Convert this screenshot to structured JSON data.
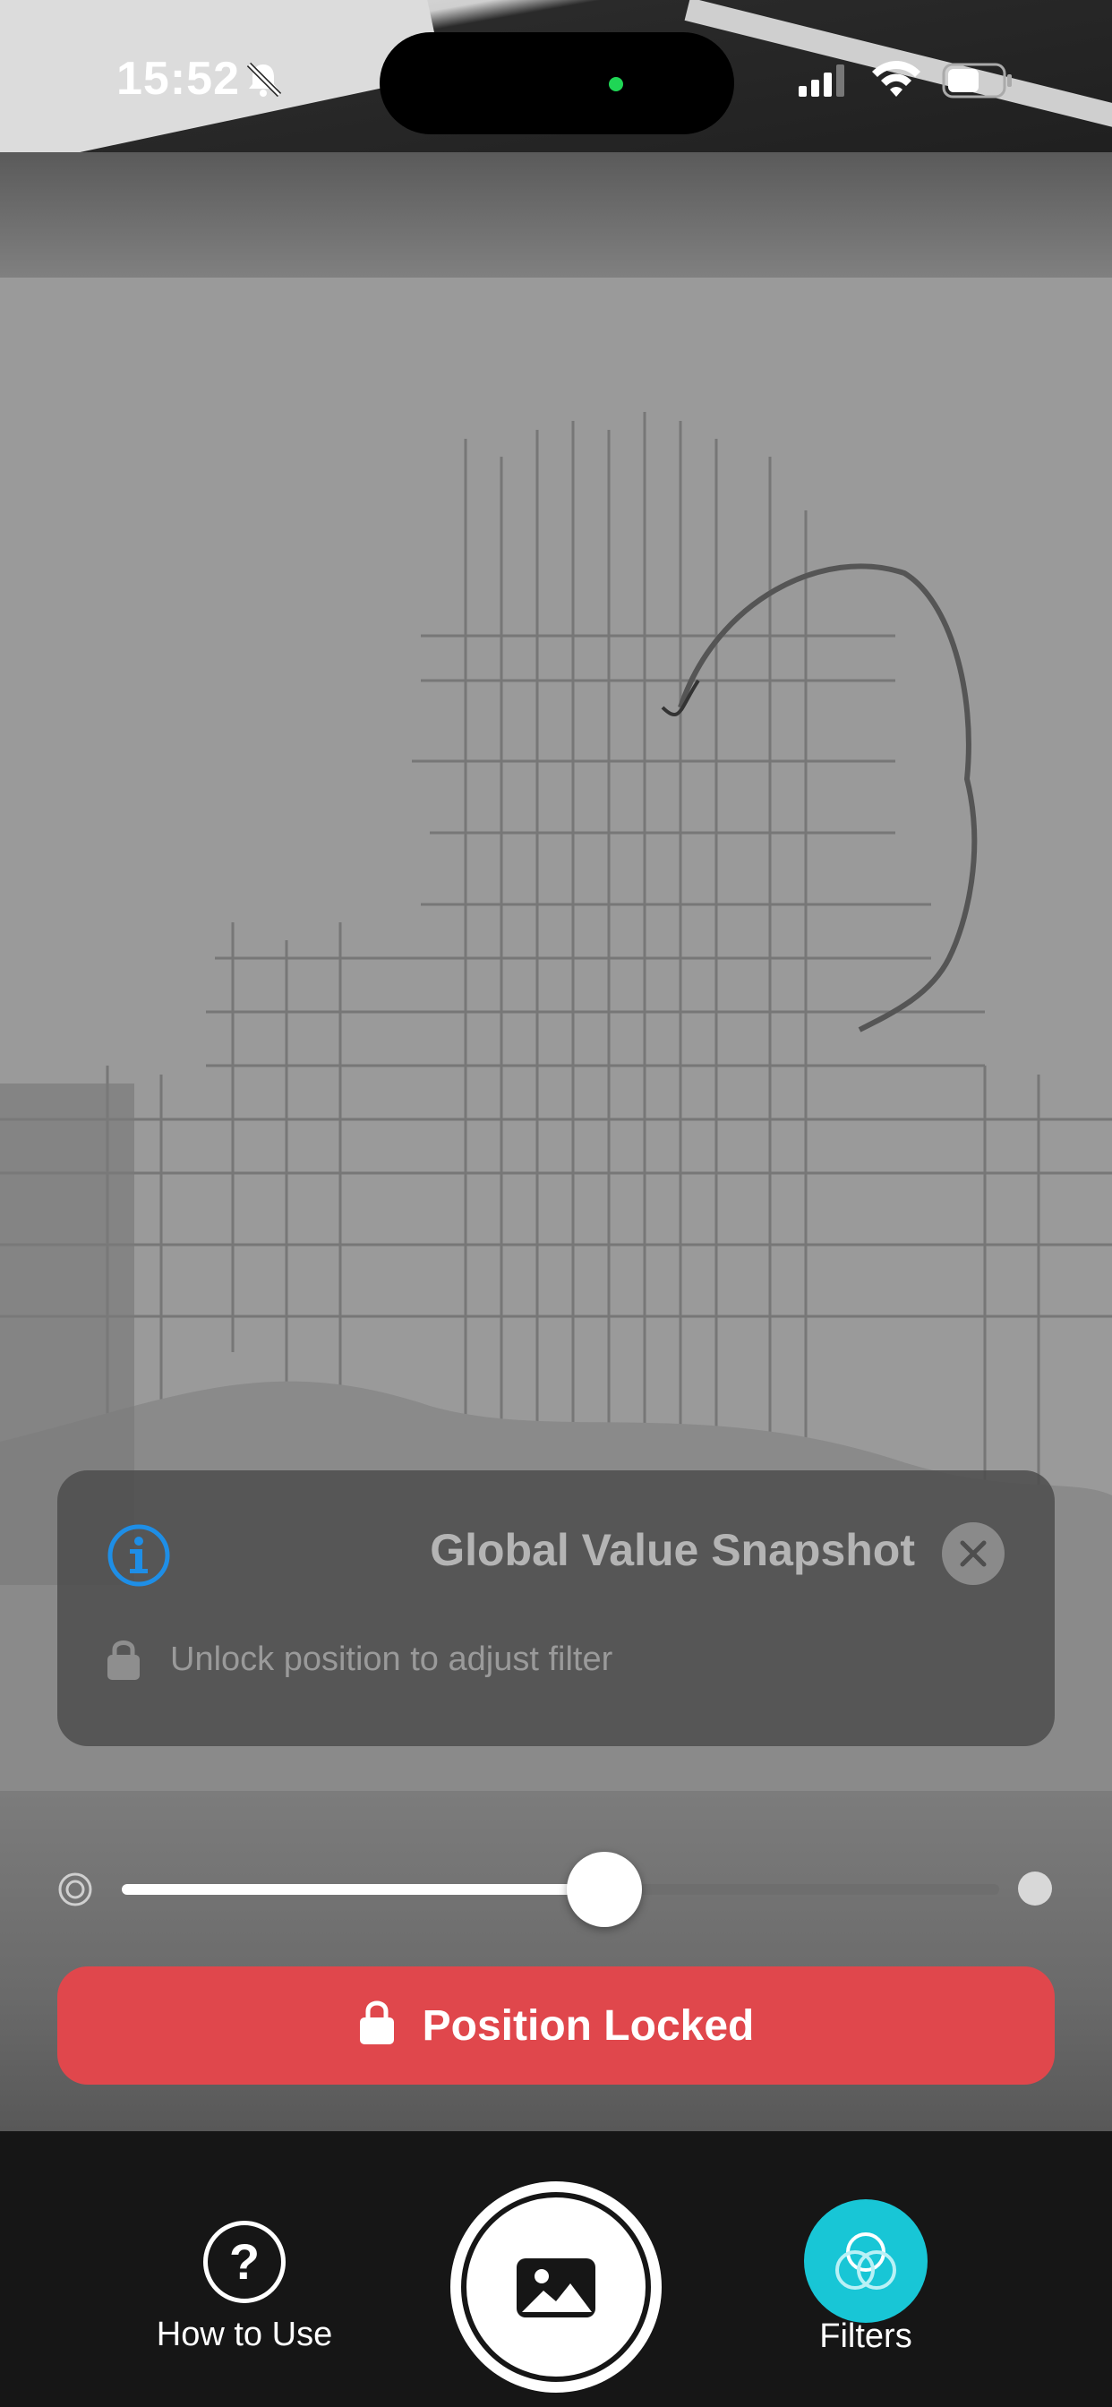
{
  "status_bar": {
    "time": "15:52"
  },
  "info_panel": {
    "title": "Global Value Snapshot",
    "hint": "Unlock position to adjust filter"
  },
  "slider": {
    "value": 0.55
  },
  "lock_button": {
    "label": "Position Locked"
  },
  "bottom_bar": {
    "how_to_label": "How to Use",
    "filters_label": "Filters"
  },
  "colors": {
    "accent_lock": "#e0474c",
    "accent_filters": "#18c6d6",
    "info_icon": "#1e8ee6"
  },
  "icons": [
    "bell-slash-icon",
    "signal-icon",
    "wifi-icon",
    "battery-icon",
    "info-icon",
    "close-icon",
    "lock-icon",
    "slider-min-icon",
    "slider-max-icon",
    "help-icon",
    "gallery-icon",
    "filters-icon"
  ]
}
